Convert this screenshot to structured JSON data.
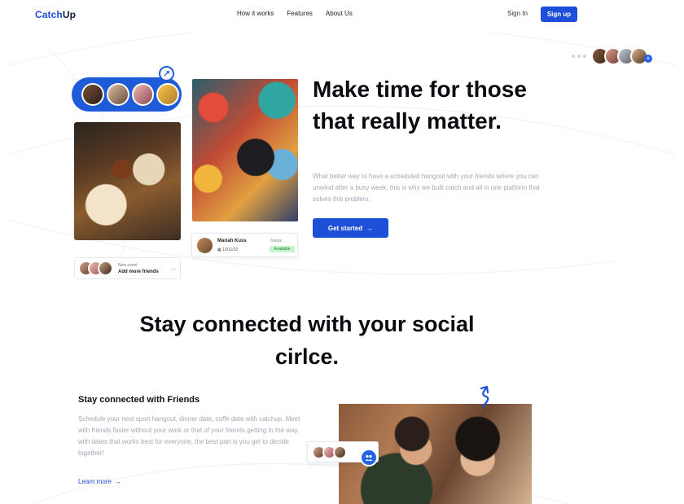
{
  "brand": {
    "part1": "Catch",
    "part2": "Up"
  },
  "nav": {
    "links": [
      "How it works",
      "Features",
      "About Us"
    ],
    "sign_in": "Sign In",
    "sign_up": "Sign up"
  },
  "hero": {
    "title": "Make time for those that really matter.",
    "description": "What better way to have a scheduled hangout with your friends where you can unwind after a busy week, this is why we built catch and all in one platform that solves this problem.",
    "cta": "Get started",
    "status_card": {
      "name": "Mariah Kuss",
      "date": "10/11/22",
      "status_label": "Status",
      "status_value": "Available"
    },
    "event_card": {
      "label": "New event",
      "title": "Add more friends"
    }
  },
  "section2": {
    "title": "Stay connected with your social cirlce.",
    "feature_title": "Stay connected with Friends",
    "feature_desc": "Schedule your next sport hangout, dinner date, coffe date with catchup. Meet with friends faster without your work or that of your friends getting in the way, with dates that works best for everyone, the best part is you get to decide together!",
    "learn_more": "Learn more"
  },
  "colors": {
    "accent": "#1e4fd9",
    "status_green_bg": "#c9f2cf",
    "status_green_text": "#1f8a3a",
    "muted_text": "#a2a8b4"
  },
  "icons": [
    "pin-icon",
    "arrow-right-icon",
    "calendar-icon",
    "plus-icon",
    "group-icon",
    "squiggle-arrow-icon"
  ]
}
